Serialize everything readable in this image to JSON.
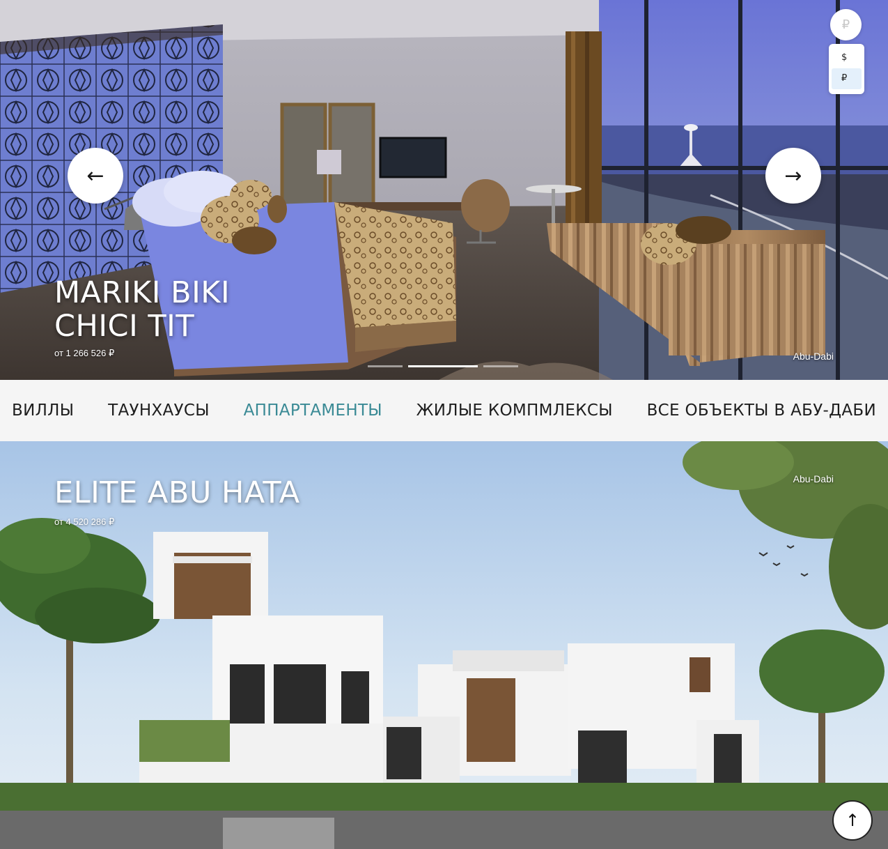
{
  "currency": {
    "current_symbol": "₽",
    "options": [
      {
        "label": "$"
      },
      {
        "label": "₽"
      }
    ],
    "selected": "₽"
  },
  "hero": {
    "prev_arrow": "←",
    "next_arrow": "→",
    "title_line1": "MARIKI BIKI",
    "title_line2": "CHICI TIT",
    "price": "от 1 266 526 ₽",
    "location": "Abu-Dabi",
    "active_slide": 2,
    "slide_count": 3
  },
  "categories": [
    {
      "label": "ВИЛЛЫ",
      "active": false
    },
    {
      "label": "ТАУНХАУСЫ",
      "active": false
    },
    {
      "label": "АППАРТАМЕНТЫ",
      "active": true
    },
    {
      "label": "ЖИЛЫЕ КОМПМЛЕКСЫ",
      "active": false
    },
    {
      "label": "ВСЕ ОБЪЕКТЫ В АБУ-ДАБИ",
      "active": false
    }
  ],
  "card2": {
    "title": "ELITE ABU HATA",
    "price": "от 4 520 286 ₽",
    "location": "Abu-Dabi"
  },
  "scroll_top": "↑",
  "colors": {
    "accent": "#3a8a95",
    "catbar_bg": "#f5f5f5",
    "currency_active_bg": "#e4f0fb"
  }
}
